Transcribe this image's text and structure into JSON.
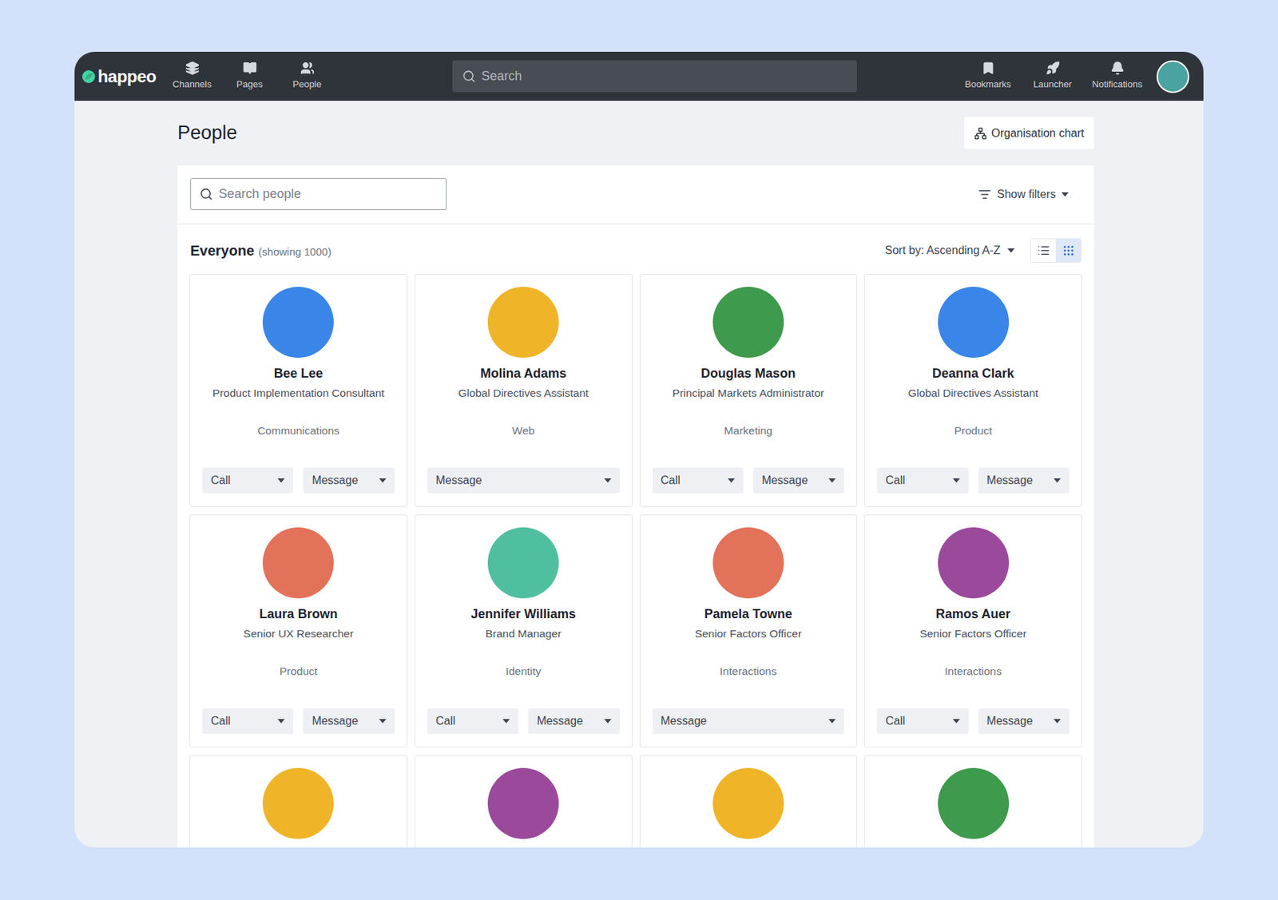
{
  "nav": {
    "logo": "happeo",
    "items": [
      {
        "label": "Channels",
        "icon": "channels"
      },
      {
        "label": "Pages",
        "icon": "pages"
      },
      {
        "label": "People",
        "icon": "people"
      }
    ],
    "search": {
      "placeholder": "Search"
    },
    "right_items": [
      {
        "label": "Bookmarks",
        "icon": "bookmarks"
      },
      {
        "label": "Launcher",
        "icon": "launcher"
      },
      {
        "label": "Notifications",
        "icon": "notifications"
      }
    ],
    "avatar_color": "#4aa3a0"
  },
  "page": {
    "title": "People",
    "org_chart_button": "Organisation chart"
  },
  "search": {
    "placeholder": "Search people"
  },
  "filters": {
    "label": "Show filters"
  },
  "section": {
    "title": "Everyone",
    "count": "(showing 1000)",
    "sort": "Sort by: Ascending A-Z",
    "views": [
      {
        "view": "list",
        "selected": false
      },
      {
        "view": "grid",
        "selected": true
      }
    ]
  },
  "people": [
    {
      "name": "Bee Lee",
      "title": "Product Implementation Consultant",
      "department": "Communications",
      "color": "#3a86e8",
      "actions": [
        "Call",
        "Message"
      ]
    },
    {
      "name": "Molina Adams",
      "title": "Global Directives Assistant",
      "department": "Web",
      "color": "#f0b429",
      "actions": [
        "Message"
      ]
    },
    {
      "name": "Douglas Mason",
      "title": "Principal Markets Administrator",
      "department": "Marketing",
      "color": "#3e9a4c",
      "actions": [
        "Call",
        "Message"
      ]
    },
    {
      "name": "Deanna Clark",
      "title": "Global Directives Assistant",
      "department": "Product",
      "color": "#3a86e8",
      "actions": [
        "Call",
        "Message"
      ]
    },
    {
      "name": "Laura Brown",
      "title": "Senior UX Researcher",
      "department": "Product",
      "color": "#e2735a",
      "actions": [
        "Call",
        "Message"
      ]
    },
    {
      "name": "Jennifer Williams",
      "title": "Brand Manager",
      "department": "Identity",
      "color": "#4fbf9f",
      "actions": [
        "Call",
        "Message"
      ]
    },
    {
      "name": "Pamela Towne",
      "title": "Senior Factors Officer",
      "department": "Interactions",
      "color": "#e2735a",
      "actions": [
        "Message"
      ]
    },
    {
      "name": "Ramos Auer",
      "title": "Senior Factors Officer",
      "department": "Interactions",
      "color": "#9b4a9b",
      "actions": [
        "Call",
        "Message"
      ]
    },
    {
      "name": "",
      "title": "",
      "department": "",
      "color": "#f0b429",
      "actions": []
    },
    {
      "name": "",
      "title": "",
      "department": "",
      "color": "#9b4a9b",
      "actions": []
    },
    {
      "name": "",
      "title": "",
      "department": "",
      "color": "#f0b429",
      "actions": []
    },
    {
      "name": "",
      "title": "",
      "department": "",
      "color": "#3e9a4c",
      "actions": []
    }
  ]
}
